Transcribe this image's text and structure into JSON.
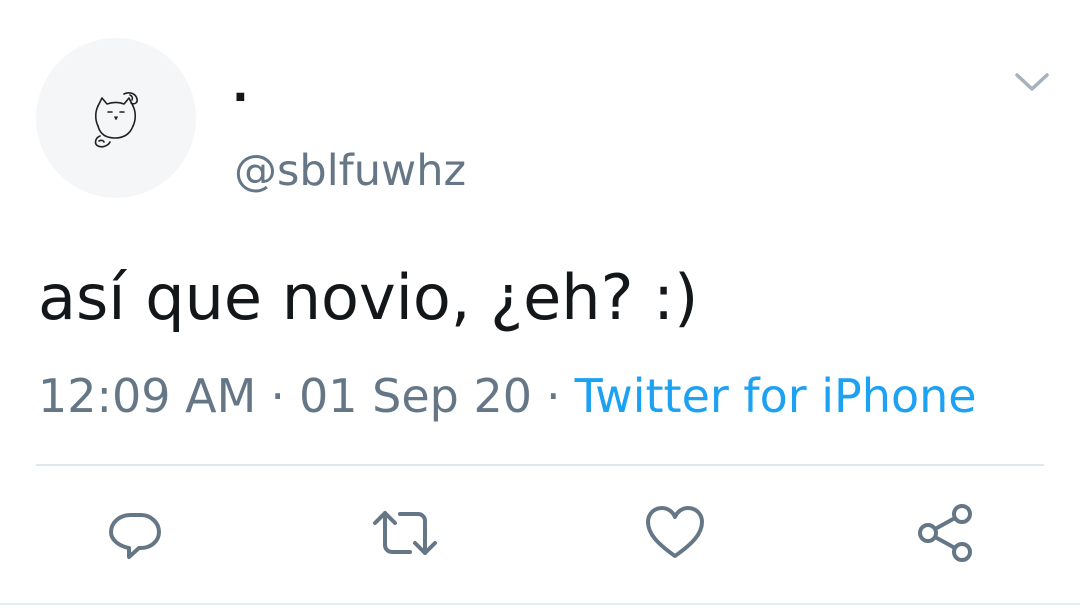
{
  "user": {
    "display_name": ".",
    "handle": "@sblfuwhz",
    "avatar_icon": "cat-doodle-icon"
  },
  "tweet": {
    "text": "así que novio, ¿eh? :)",
    "time": "12:09 AM",
    "date": "01 Sep 20",
    "separator": "·",
    "source": "Twitter for iPhone"
  },
  "actions": {
    "reply_icon": "reply-icon",
    "retweet_icon": "retweet-icon",
    "like_icon": "heart-icon",
    "share_icon": "share-icon"
  },
  "colors": {
    "text": "#14171a",
    "secondary": "#657786",
    "link": "#1da1f2",
    "icon": "#657786",
    "divider": "#e1e8ed"
  }
}
